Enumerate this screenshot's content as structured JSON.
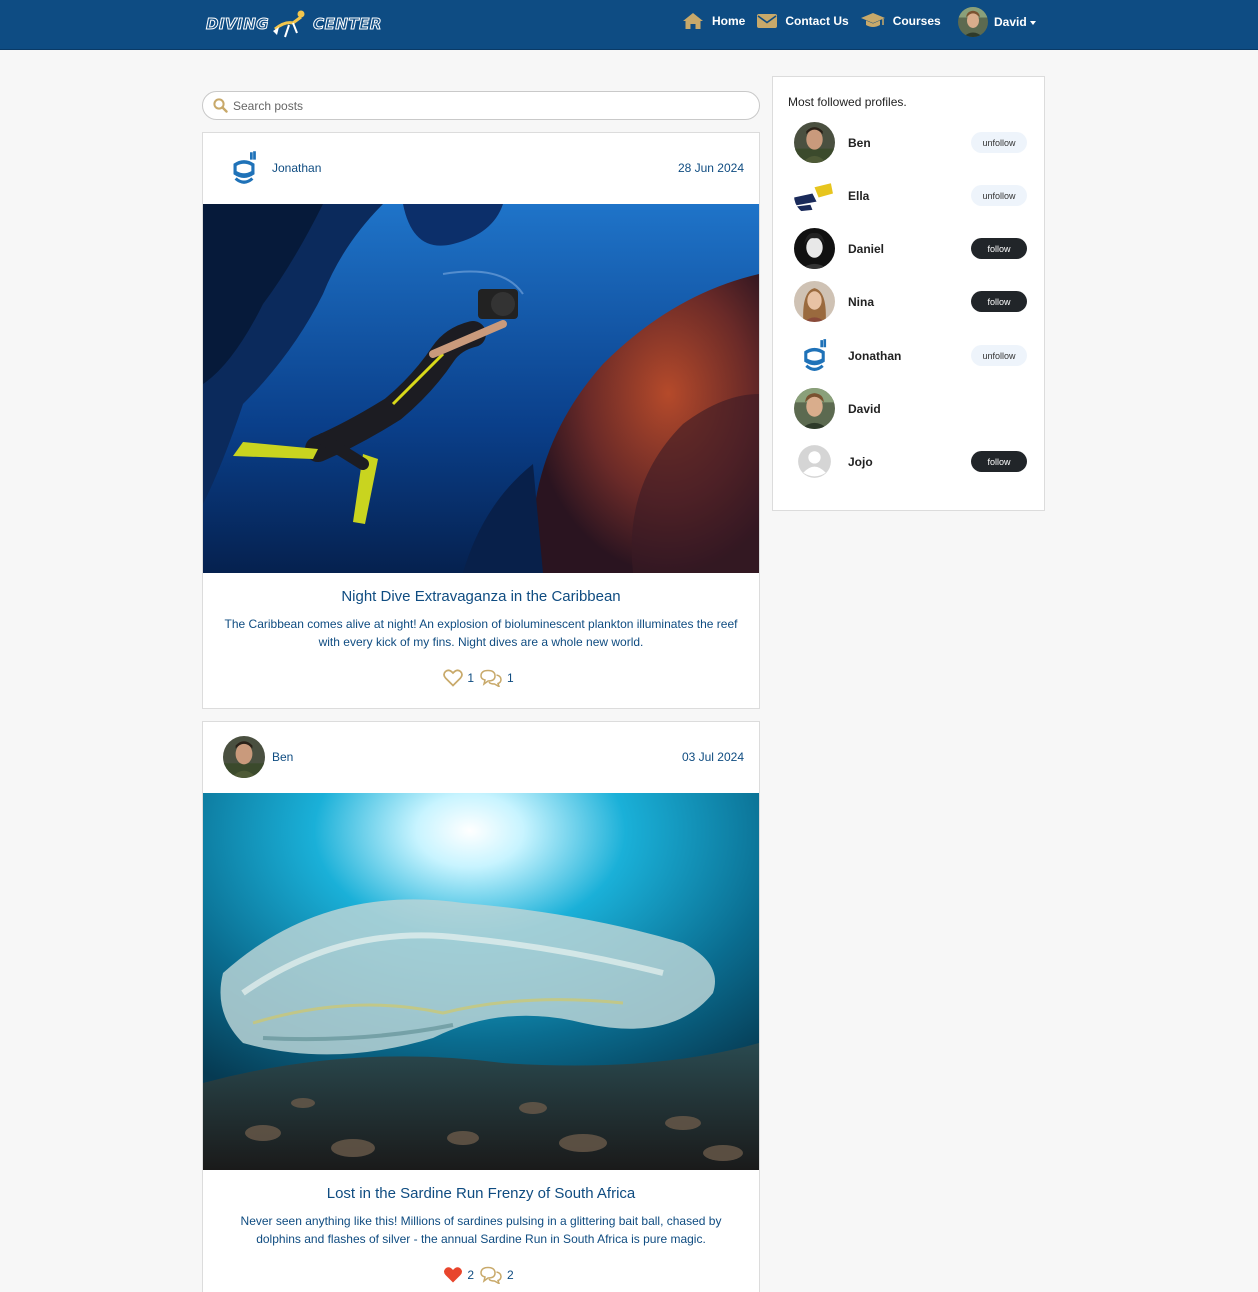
{
  "brand": {
    "left": "DIVING",
    "right": "CENTER"
  },
  "nav": {
    "links": [
      {
        "label": "Home",
        "icon": "home-icon"
      },
      {
        "label": "Contact Us",
        "icon": "envelope-icon"
      },
      {
        "label": "Courses",
        "icon": "graduation-cap-icon"
      }
    ],
    "user": {
      "name": "David"
    }
  },
  "search": {
    "placeholder": "Search posts",
    "value": ""
  },
  "posts": [
    {
      "author": "Jonathan",
      "date": "28 Jun 2024",
      "title": "Night Dive Extravaganza in the Caribbean",
      "body": "The Caribbean comes alive at night! An explosion of bioluminescent plankton illuminates the reef with every kick of my fins. Night dives are a whole new world.",
      "likes": "1",
      "comments": "1",
      "liked": false
    },
    {
      "author": "Ben",
      "date": "03 Jul 2024",
      "title": "Lost in the Sardine Run Frenzy of South Africa",
      "body": "Never seen anything like this! Millions of sardines pulsing in a glittering bait ball, chased by dolphins and flashes of silver - the annual Sardine Run in South Africa is pure magic.",
      "likes": "2",
      "comments": "2",
      "liked": true
    }
  ],
  "sidebar": {
    "title": "Most followed profiles.",
    "profiles": [
      {
        "name": "Ben",
        "button": "unfollow"
      },
      {
        "name": "Ella",
        "button": "unfollow"
      },
      {
        "name": "Daniel",
        "button": "follow"
      },
      {
        "name": "Nina",
        "button": "follow"
      },
      {
        "name": "Jonathan",
        "button": "unfollow"
      },
      {
        "name": "David",
        "button": ""
      },
      {
        "name": "Jojo",
        "button": "follow"
      }
    ]
  },
  "colors": {
    "navbar": "#0e4c83",
    "accent_gold": "#c8a96a",
    "text_blue": "#0f4c81",
    "like_red": "#e8452c"
  }
}
